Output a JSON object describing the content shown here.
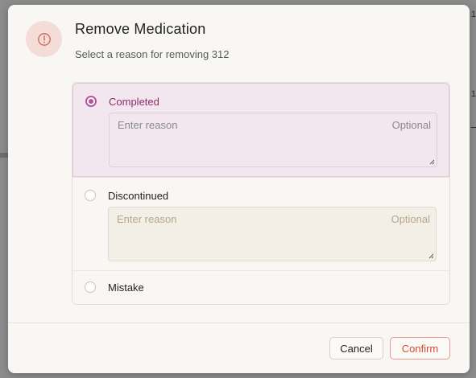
{
  "background": {
    "glimpse_top": "1",
    "glimpse_mid": "1"
  },
  "dialog": {
    "title": "Remove Medication",
    "subtitle": "Select a reason for removing 312",
    "icon": "alert-circle-icon",
    "accent_color": "#b4549a",
    "options": [
      {
        "label": "Completed",
        "selected": true,
        "reason_placeholder": "Enter reason",
        "reason_tag": "Optional",
        "reason_value": ""
      },
      {
        "label": "Discontinued",
        "selected": false,
        "reason_placeholder": "Enter reason",
        "reason_tag": "Optional",
        "reason_value": ""
      },
      {
        "label": "Mistake",
        "selected": false
      }
    ],
    "buttons": {
      "cancel": "Cancel",
      "confirm": "Confirm"
    }
  }
}
